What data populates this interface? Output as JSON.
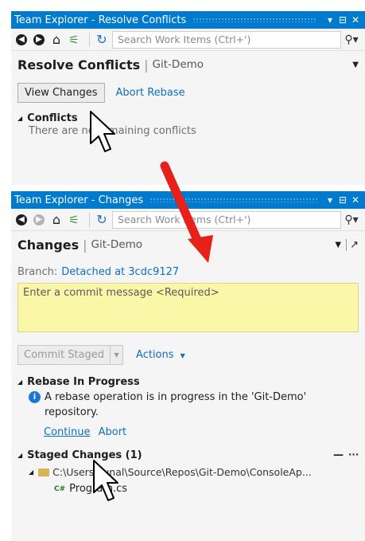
{
  "panel1": {
    "title": "Team Explorer - Resolve Conflicts",
    "search_placeholder": "Search Work Items (Ctrl+')",
    "header": {
      "title": "Resolve Conflicts",
      "repo": "Git-Demo"
    },
    "buttons": {
      "view_changes": "View Changes",
      "abort_rebase": "Abort Rebase"
    },
    "conflicts": {
      "heading": "Conflicts",
      "message": "There are no remaining conflicts"
    }
  },
  "panel2": {
    "title": "Team Explorer - Changes",
    "search_placeholder": "Search Work Items (Ctrl+')",
    "header": {
      "title": "Changes",
      "repo": "Git-Demo"
    },
    "branch": {
      "label": "Branch:",
      "value": "Detached at 3cdc9127"
    },
    "commit_placeholder": "Enter a commit message <Required>",
    "commit_staged": "Commit Staged",
    "actions": "Actions",
    "rebase": {
      "heading": "Rebase In Progress",
      "message": "A rebase operation is in progress in the 'Git-Demo' repository.",
      "continue": "Continue",
      "abort": "Abort"
    },
    "staged": {
      "heading": "Staged Changes (1)",
      "path": "C:\\Users\\kunal\\Source\\Repos\\Git-Demo\\ConsoleAp...",
      "file_badge": "C#",
      "file": "Program.cs"
    }
  },
  "colors": {
    "titlebar": "#007acc",
    "link": "#0e70c0",
    "commit_box": "#fbf7a8",
    "arrow": "#e8201c"
  }
}
